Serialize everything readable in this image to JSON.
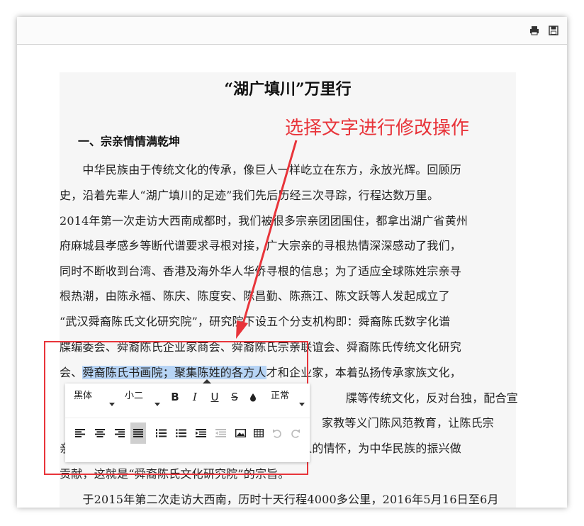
{
  "toolbar_top": {
    "print_icon": "print-icon",
    "save_icon": "save-icon"
  },
  "document": {
    "title": "“湖广填川”万里行",
    "section_heading": "一、宗亲情情满乾坤",
    "lines": [
      "　　中华民族由于传统文化的传承，像巨人一样屹立在东方，永放光辉。回顾历",
      "史，沿着先辈人“湖广填川的足迹”我们先后历经三次寻踪，行程达数万里。",
      "2014年第一次走访大西南成都时，我们被很多宗亲团团围住，都拿出湖广省黄州",
      "府麻城县孝感乡等断代谱要求寻根对接，广大宗亲的寻根热情深深感动了我们，",
      "同时不断收到台湾、香港及海外华人华侨寻根的信息；为了适应全球陈姓宗亲寻",
      "根热潮，由陈永福、陈庆、陈度安、陈昌勤、陈燕江、陈文跃等人发起成立了",
      "“武汉舜裔陈氏文化研究院”，研究院下设五个分支机构即：舜裔陈氏数字化谱",
      "牒编委会、舜裔陈氏企业家商会、舜裔陈氏宗亲联谊会、舜裔陈氏传统文化研究",
      "会、",
      "舜裔陈氏书画院；聚集陈姓的各方人",
      "才和企业家，本着弘扬传承家族文化，",
      "牒等传统文化，反对台独，配合宣",
      "家教等义门陈风范教育，让陈氏宗",
      "亲成为爱家、爱族、爱国模范，凝聚全球陈氏华人的情怀，为中华民族的振兴做",
      "贡献，这就是“舜裔陈氏文化研究院”的宗旨。",
      "　　于2015年第二次走访大西南，历时十天行程4000多公里，2016年5月16日至6月"
    ]
  },
  "annotation": {
    "text": "选择文字进行修改操作"
  },
  "editor_toolbar": {
    "font_family": "黑体",
    "font_size": "小二",
    "bold": "B",
    "italic": "I",
    "underline": "U",
    "strike": "S",
    "line_spacing": "正常",
    "icons": [
      "align-left-icon",
      "align-center-icon",
      "align-right-icon",
      "align-justify-icon",
      "ordered-list-icon",
      "unordered-list-icon",
      "indent-icon",
      "outdent-icon",
      "image-icon",
      "table-icon",
      "undo-icon",
      "redo-icon",
      "color-drop-icon"
    ],
    "accent": "#e8343a",
    "highlight": "#b7d4f5"
  }
}
